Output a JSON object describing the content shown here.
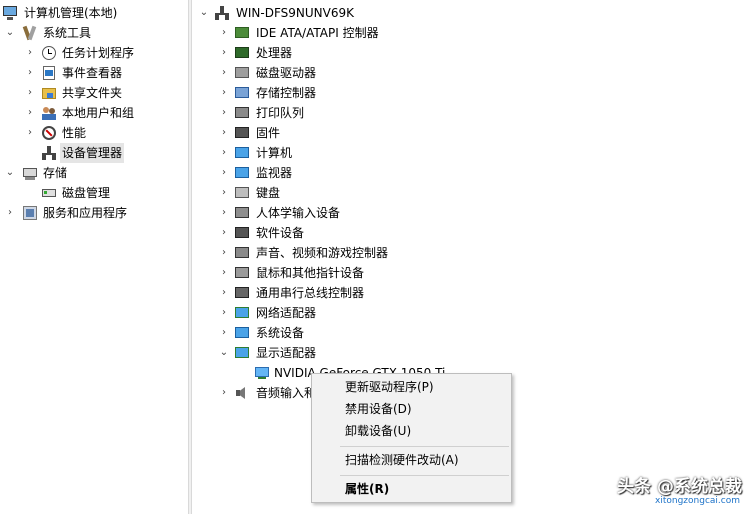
{
  "left_tree": {
    "root": "计算机管理(本地)",
    "system_tools": "系统工具",
    "task_scheduler": "任务计划程序",
    "event_viewer": "事件查看器",
    "shared_folders": "共享文件夹",
    "local_users": "本地用户和组",
    "performance": "性能",
    "device_manager": "设备管理器",
    "storage": "存储",
    "disk_mgmt": "磁盘管理",
    "services_apps": "服务和应用程序"
  },
  "device_tree": {
    "computer_name": "WIN-DFS9NUNV69K",
    "categories": [
      "IDE ATA/ATAPI 控制器",
      "处理器",
      "磁盘驱动器",
      "存储控制器",
      "打印队列",
      "固件",
      "计算机",
      "监视器",
      "键盘",
      "人体学输入设备",
      "软件设备",
      "声音、视频和游戏控制器",
      "鼠标和其他指针设备",
      "通用串行总线控制器",
      "网络适配器",
      "系统设备",
      "显示适配器"
    ],
    "display_child": "NVIDIA GeForce GTX 1050 Ti",
    "audio_io": "音频输入和输出"
  },
  "context_menu": {
    "update_driver": "更新驱动程序(P)",
    "disable_device": "禁用设备(D)",
    "uninstall_device": "卸载设备(U)",
    "scan_hw": "扫描检测硬件改动(A)",
    "properties": "属性(R)"
  },
  "watermark": {
    "text": "头条 @系统总裁",
    "url": "xitongzongcai.com"
  },
  "colors": {
    "selection": "#e5e5e5",
    "accent": "#0078d7",
    "menu_bg": "#f2f2f2"
  }
}
